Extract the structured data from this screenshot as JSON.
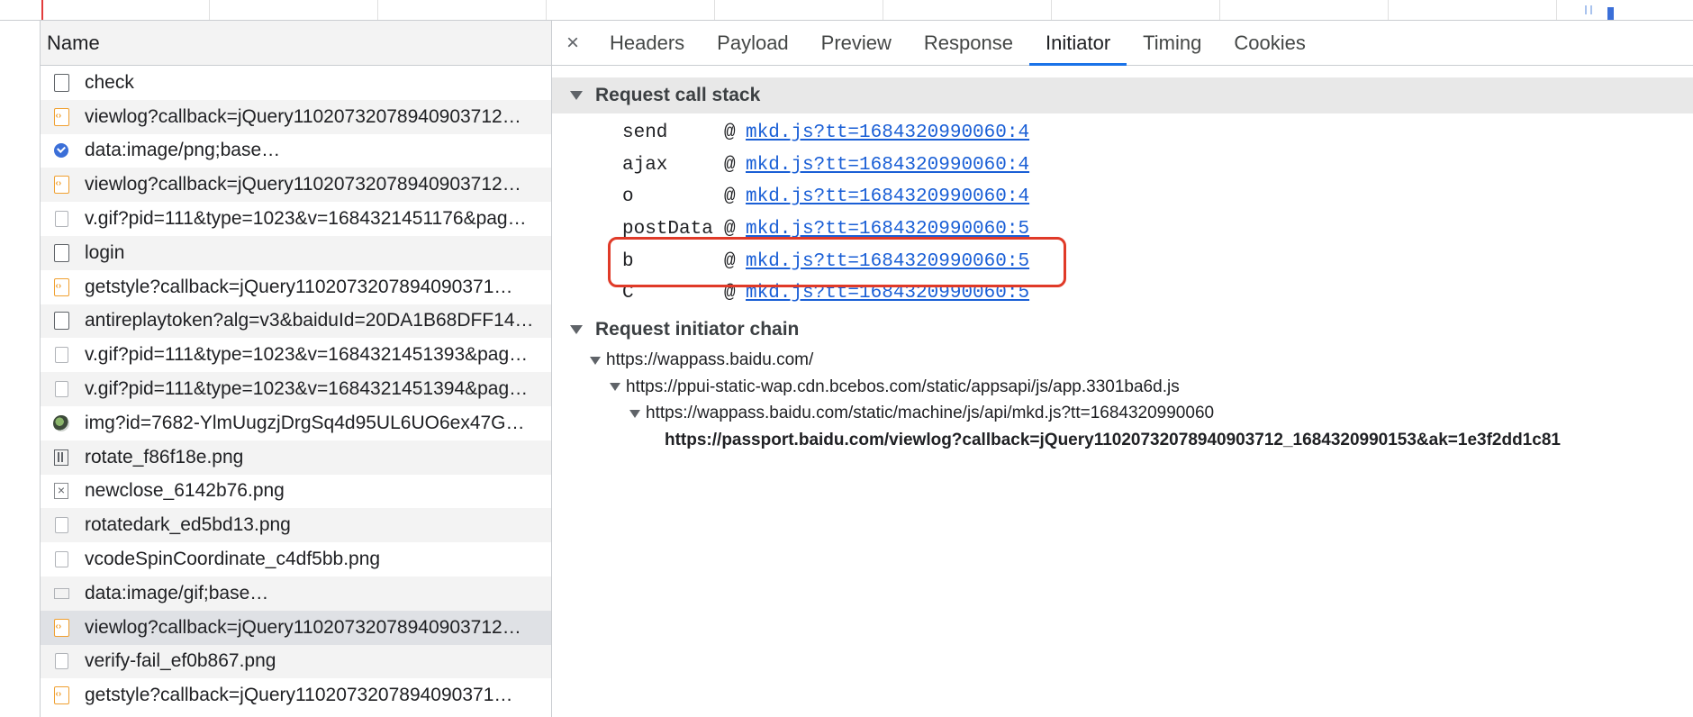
{
  "list": {
    "header": "Name",
    "rows": [
      {
        "name": "check",
        "icon": "document-icon"
      },
      {
        "name": "viewlog?callback=jQuery11020732078940903712…",
        "icon": "script-icon"
      },
      {
        "name": "data:image/png;base…",
        "icon": "check-circle-icon"
      },
      {
        "name": "viewlog?callback=jQuery11020732078940903712…",
        "icon": "script-icon"
      },
      {
        "name": "v.gif?pid=111&type=1023&v=1684321451176&pag…",
        "icon": "document-light-icon"
      },
      {
        "name": "login",
        "icon": "document-icon"
      },
      {
        "name": "getstyle?callback=jQuery1102073207894090371…",
        "icon": "script-icon"
      },
      {
        "name": "antireplaytoken?alg=v3&baiduId=20DA1B68DFF14…",
        "icon": "document-icon"
      },
      {
        "name": "v.gif?pid=111&type=1023&v=1684321451393&pag…",
        "icon": "document-light-icon"
      },
      {
        "name": "v.gif?pid=111&type=1023&v=1684321451394&pag…",
        "icon": "document-light-icon"
      },
      {
        "name": "img?id=7682-YlmUugzjDrgSq4d95UL6UO6ex47G…",
        "icon": "image-thumbnail-icon"
      },
      {
        "name": "rotate_f86f18e.png",
        "icon": "rotate-icon"
      },
      {
        "name": "newclose_6142b76.png",
        "icon": "close-image-icon"
      },
      {
        "name": "rotatedark_ed5bd13.png",
        "icon": "document-light-icon"
      },
      {
        "name": "vcodeSpinCoordinate_c4df5bb.png",
        "icon": "document-light-icon"
      },
      {
        "name": "data:image/gif;base…",
        "icon": "bar-icon"
      },
      {
        "name": "viewlog?callback=jQuery11020732078940903712…",
        "icon": "script-icon"
      },
      {
        "name": "verify-fail_ef0b867.png",
        "icon": "document-light-icon"
      },
      {
        "name": "getstyle?callback=jQuery1102073207894090371…",
        "icon": "script-icon"
      }
    ]
  },
  "tabs": {
    "close": "×",
    "items": [
      "Headers",
      "Payload",
      "Preview",
      "Response",
      "Initiator",
      "Timing",
      "Cookies"
    ],
    "active": "Initiator"
  },
  "call_stack": {
    "title": "Request call stack",
    "frames": [
      {
        "fn": "send",
        "loc": "mkd.js?tt=1684320990060:4"
      },
      {
        "fn": "ajax",
        "loc": "mkd.js?tt=1684320990060:4"
      },
      {
        "fn": "o",
        "loc": "mkd.js?tt=1684320990060:4"
      },
      {
        "fn": "postData",
        "loc": "mkd.js?tt=1684320990060:5"
      },
      {
        "fn": "b",
        "loc": "mkd.js?tt=1684320990060:5"
      },
      {
        "fn": "C",
        "loc": "mkd.js?tt=1684320990060:5"
      }
    ],
    "highlighted_frame": "postData"
  },
  "initiator_chain": {
    "title": "Request initiator chain",
    "items": [
      "https://wappass.baidu.com/",
      "https://ppui-static-wap.cdn.bcebos.com/static/appsapi/js/app.3301ba6d.js",
      "https://wappass.baidu.com/static/machine/js/api/mkd.js?tt=1684320990060",
      "https://passport.baidu.com/viewlog?callback=jQuery11020732078940903712_1684320990153&ak=1e3f2dd1c81"
    ]
  },
  "colors": {
    "accent": "#1a73e8",
    "link": "#1a5fd6",
    "highlight_box": "#e03a28"
  }
}
